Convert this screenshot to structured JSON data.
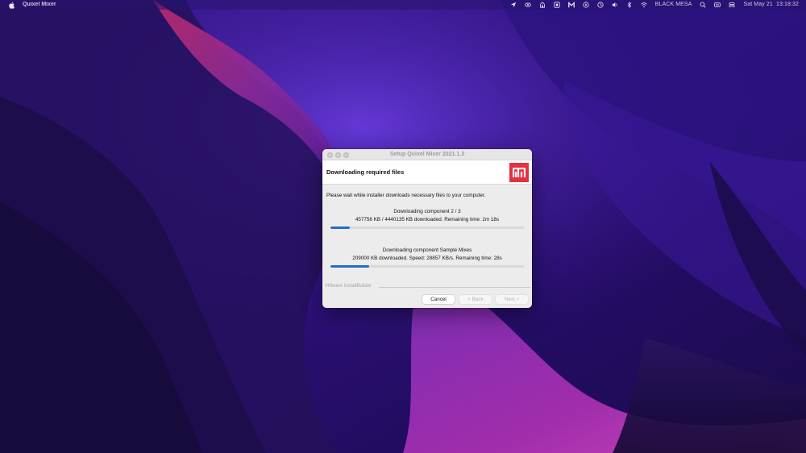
{
  "menubar": {
    "app_name": "Quixel Mixer",
    "status_icons": [
      "location-icon",
      "eye-icon",
      "dashboard-icon",
      "tray-icon",
      "m-app-icon",
      "play-circle-icon",
      "clock-icon",
      "volume-icon",
      "bluetooth-icon",
      "wifi-icon"
    ],
    "network_name": "BLACK MESA",
    "right_icons": [
      "search-icon",
      "keyboard-icon",
      "control-center-icon"
    ],
    "datetime": "Sat May 21  13:18:32"
  },
  "dialog": {
    "window_title": "Setup Quixel Mixer 2021.1.3",
    "header_title": "Downloading required files",
    "instruction": "Please wait while installer downloads necessary files to your computer.",
    "component1": {
      "title": "Downloading component 2 / 3",
      "detail": "457756 KB / 4440135 KB downloaded. Remaining time: 2m 18s",
      "progress_percent": 10
    },
    "component2": {
      "title": "Downloading component Sample Mixes",
      "detail": "209000 KB downloaded. Speed: 28857 KB/s. Remaining time:  28s",
      "progress_percent": 20
    },
    "brand": "VMware InstallBuilder",
    "buttons": {
      "cancel": "Cancel",
      "back": "< Back",
      "next": "Next >"
    },
    "logo_color": "#e3313f",
    "progress_color": "#1f6dd1"
  },
  "colors": {
    "wallpaper_base": "#2a0f6e",
    "wallpaper_accent": "#b0277a"
  }
}
